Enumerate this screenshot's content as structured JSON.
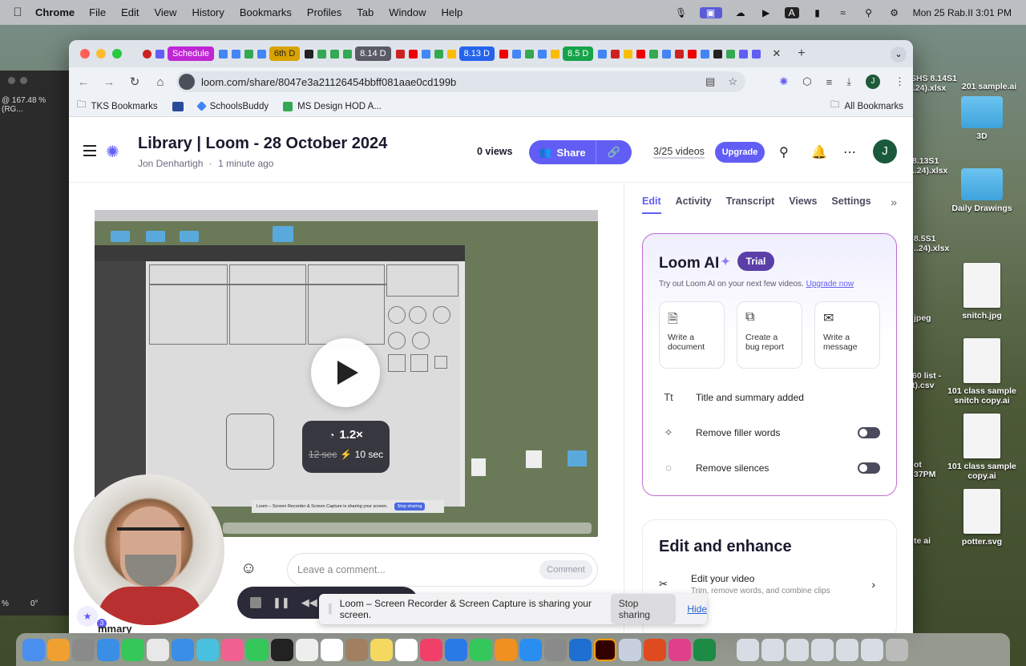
{
  "menubar": {
    "app": "Chrome",
    "items": [
      "File",
      "Edit",
      "View",
      "History",
      "Bookmarks",
      "Profiles",
      "Tab",
      "Window",
      "Help"
    ],
    "clock": "Mon 25 Rab.II  3:01 PM"
  },
  "tabs": {
    "group_labels": [
      "Schedule",
      "6th D",
      "8.14 D",
      "8.13 D",
      "8.5 D"
    ],
    "group_colors": [
      "#c026d3",
      "#d9a300",
      "#5a5a66",
      "#2563eb",
      "#16a34a"
    ]
  },
  "toolbar": {
    "url": "loom.com/share/8047e3a21126454bbff081aae0cd199b",
    "profile_initial": "J"
  },
  "bookmarks": {
    "items": [
      "TKS Bookmarks",
      "SchoolsBuddy",
      "MS Design HOD A..."
    ],
    "all": "All Bookmarks"
  },
  "loom": {
    "title": "Library | Loom - 28 October 2024",
    "author": "Jon Denhartigh",
    "time_ago": "1 minute ago",
    "views": "0 views",
    "share_label": "Share",
    "video_count": "3/25 videos",
    "upgrade_label": "Upgrade",
    "avatar_initial": "J"
  },
  "player": {
    "speed": "1.2×",
    "original_time": "12 sec",
    "saved_time": "10 sec",
    "comment_placeholder": "Leave a comment...",
    "comment_button": "Comment"
  },
  "panel": {
    "tabs": [
      "Edit",
      "Activity",
      "Transcript",
      "Views",
      "Settings"
    ],
    "active_tab": "Edit",
    "ai_title": "Loom AI",
    "trial_label": "Trial",
    "ai_description": "Try out Loom AI on your next few videos.",
    "ai_upgrade_link": "Upgrade now",
    "ai_options": [
      {
        "line1": "Write a",
        "line2": "document",
        "icon": "document-icon"
      },
      {
        "line1": "Create a",
        "line2": "bug report",
        "icon": "bug-report-icon"
      },
      {
        "line1": "Write a",
        "line2": "message",
        "icon": "message-icon"
      }
    ],
    "ai_rows": [
      {
        "label": "Title and summary added",
        "icon": "title-icon",
        "toggle": false
      },
      {
        "label": "Remove filler words",
        "icon": "filler-icon",
        "toggle": true,
        "on": false
      },
      {
        "label": "Remove silences",
        "icon": "silence-icon",
        "toggle": true,
        "on": false
      }
    ],
    "enhance_title": "Edit and enhance",
    "enhance_row_title": "Edit your video",
    "enhance_row_sub": "Trim, remove words, and combine clips",
    "link_row_partial": "d a link"
  },
  "sharebar": {
    "message": "Loom – Screen Recorder & Screen Capture is sharing your screen.",
    "stop_label": "Stop sharing",
    "hide_label": "Hide"
  },
  "desktop": {
    "left_zoom": "@ 167.48 % (RG...",
    "left_bottom_1": "%",
    "left_bottom_2": "0°",
    "icons": [
      {
        "label": "3D"
      },
      {
        "label": "Daily Drawings"
      },
      {
        "label": "snitch.jpg"
      },
      {
        "label": "101 class sample snitch copy.ai"
      },
      {
        "label": "101 class sample copy.ai"
      },
      {
        "label": "potter.svg"
      }
    ],
    "partial_labels": [
      "SHS 8.14S1",
      "..24).xlsx",
      "201 sample.ai",
      "8.13S1",
      "..24).xlsx",
      "8.5S1",
      "..24).xlsx",
      "jpeg",
      "60 list -",
      "t).csv",
      "ot",
      "37PM",
      "te ai"
    ]
  },
  "summary_partial": "mmary",
  "webcam_badge": "3"
}
